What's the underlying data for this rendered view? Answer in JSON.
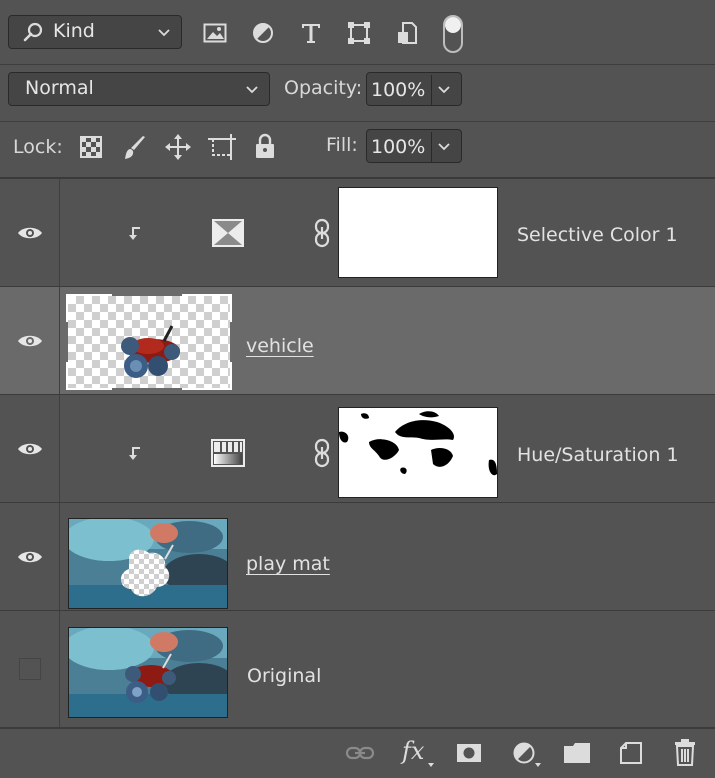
{
  "filter": {
    "kind_label": "Kind"
  },
  "blend": {
    "mode": "Normal",
    "opacity_label": "Opacity:",
    "opacity_value": "100%"
  },
  "lock": {
    "label": "Lock:",
    "fill_label": "Fill:",
    "fill_value": "100%"
  },
  "layers": [
    {
      "name": "Selective Color 1",
      "visible": true
    },
    {
      "name": "vehicle",
      "visible": true,
      "selected": true
    },
    {
      "name": "Hue/Saturation 1",
      "visible": true
    },
    {
      "name": "play mat",
      "visible": true
    },
    {
      "name": "Original",
      "visible": false
    }
  ],
  "bottom": {
    "fx_label": "fx"
  }
}
